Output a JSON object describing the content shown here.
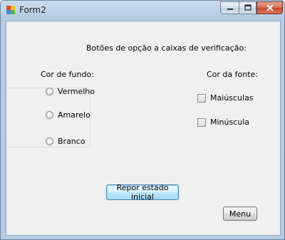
{
  "window": {
    "title": "Form2"
  },
  "heading": "Botões de opção a caixas de verificação:",
  "background_group": {
    "label": "Cor de fundo:",
    "options": [
      "Vermelho",
      "Amarelo",
      "Branco"
    ]
  },
  "font_group": {
    "label": "Cor da fonte:",
    "options": [
      "Maiúsculas",
      "Minúscula"
    ]
  },
  "buttons": {
    "reset": "Repor estado inicial",
    "menu": "Menu"
  },
  "colors": {
    "client_bg": "#f0f0f0",
    "titlebar": "#b6cce2",
    "close_button": "#c3472c",
    "focus_border": "#3c7fb1"
  }
}
